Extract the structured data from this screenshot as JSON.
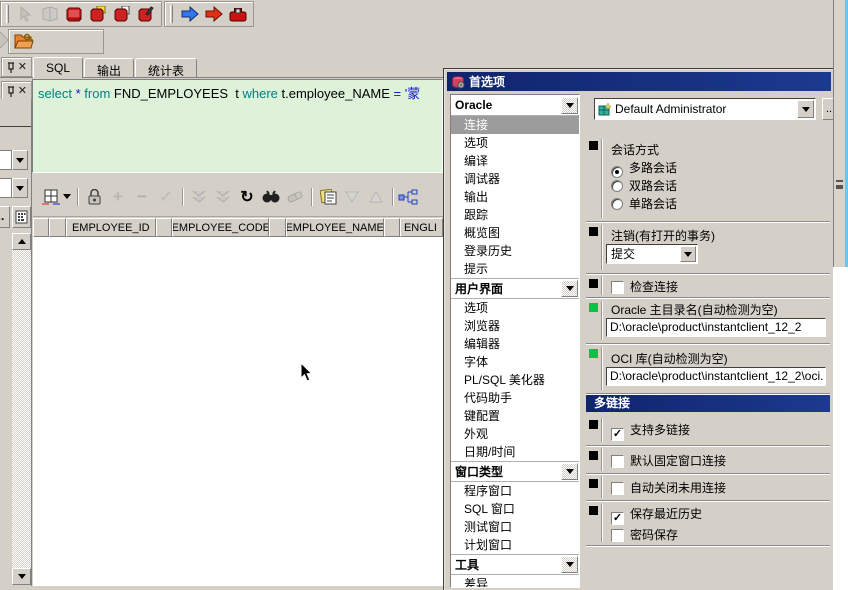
{
  "toolbar_main": {
    "row1_icons": [
      "pointer-tool",
      "book-disabled",
      "book-red",
      "book-note",
      "book-copy",
      "book-edit",
      "arrow-blue-forward",
      "arrow-red-forward",
      "stop-case"
    ],
    "row2_icons": [
      "open-folder-key"
    ]
  },
  "tabs": [
    {
      "label": "SQL",
      "active": true
    },
    {
      "label": "输出",
      "active": false
    },
    {
      "label": "统计表",
      "active": false
    }
  ],
  "sql": {
    "tokens": [
      {
        "t": "select",
        "c": "kw"
      },
      {
        "t": " ",
        "c": "id"
      },
      {
        "t": "*",
        "c": "sym"
      },
      {
        "t": " ",
        "c": "id"
      },
      {
        "t": "from",
        "c": "kw"
      },
      {
        "t": " FND_EMPLOYEES  t ",
        "c": "id"
      },
      {
        "t": "where",
        "c": "kw"
      },
      {
        "t": " t.employee_NAME ",
        "c": "id"
      },
      {
        "t": "=",
        "c": "sym"
      },
      {
        "t": " ",
        "c": "id"
      },
      {
        "t": "'蒙",
        "c": "str"
      }
    ]
  },
  "grid": {
    "toolbar_icons": [
      "grid-view",
      "record-lock",
      "insert-record",
      "delete-record",
      "post-record",
      "fetch-next-page",
      "fetch-last-page",
      "refresh",
      "find",
      "clear",
      "export-data",
      "sort-descending",
      "sort-ascending",
      "linked-query"
    ],
    "columns": [
      "EMPLOYEE_ID",
      "EMPLOYEE_CODE",
      "EMPLOYEE_NAME",
      "ENGLI"
    ]
  },
  "dialog": {
    "title": "首选项",
    "profile": {
      "value": "Default Administrator",
      "more_label": ".."
    },
    "nav": [
      {
        "label": "Oracle",
        "items": [
          {
            "label": "连接",
            "selected": true
          },
          {
            "label": "选项",
            "selected": false
          },
          {
            "label": "编译",
            "selected": false
          },
          {
            "label": "调试器",
            "selected": false
          },
          {
            "label": "输出",
            "selected": false
          },
          {
            "label": "跟踪",
            "selected": false
          },
          {
            "label": "概览图",
            "selected": false
          },
          {
            "label": "登录历史",
            "selected": false
          },
          {
            "label": "提示",
            "selected": false
          }
        ]
      },
      {
        "label": "用户界面",
        "items": [
          {
            "label": "选项",
            "selected": false
          },
          {
            "label": "浏览器",
            "selected": false
          },
          {
            "label": "编辑器",
            "selected": false
          },
          {
            "label": "字体",
            "selected": false
          },
          {
            "label": "PL/SQL 美化器",
            "selected": false
          },
          {
            "label": "代码助手",
            "selected": false
          },
          {
            "label": "键配置",
            "selected": false
          },
          {
            "label": "外观",
            "selected": false
          },
          {
            "label": "日期/时间",
            "selected": false
          }
        ]
      },
      {
        "label": "窗口类型",
        "items": [
          {
            "label": "程序窗口",
            "selected": false
          },
          {
            "label": "SQL 窗口",
            "selected": false
          },
          {
            "label": "测试窗口",
            "selected": false
          },
          {
            "label": "计划窗口",
            "selected": false
          }
        ]
      },
      {
        "label": "工具",
        "items": [
          {
            "label": "差异",
            "selected": false
          }
        ]
      }
    ],
    "session_mode": {
      "title": "会话方式",
      "options": [
        {
          "label": "多路会话",
          "selected": true
        },
        {
          "label": "双路会话",
          "selected": false
        },
        {
          "label": "单路会话",
          "selected": false
        }
      ]
    },
    "logoff": {
      "label": "注销(有打开的事务)",
      "value": "提交"
    },
    "check_connection": {
      "label": "检查连接",
      "checked": false
    },
    "oracle_home": {
      "label": "Oracle 主目录名(自动检测为空)",
      "value": "D:\\oracle\\product\\instantclient_12_2"
    },
    "oci_library": {
      "label": "OCI 库(自动检测为空)",
      "value": "D:\\oracle\\product\\instantclient_12_2\\oci."
    },
    "multilink": {
      "title": "多链接",
      "checks": [
        {
          "label": "支持多链接",
          "checked": true
        },
        {
          "label": "默认固定窗口连接",
          "checked": false
        },
        {
          "label": "自动关闭未用连接",
          "checked": false
        },
        {
          "label": "保存最近历史",
          "checked": true
        },
        {
          "label": "密码保存",
          "checked": false
        }
      ]
    }
  },
  "colors": {
    "titlebar": "#10246e",
    "editor_bg": "#def2da",
    "keyword": "#007f80",
    "symbol": "#1414c8",
    "selected_nav_bg": "#9c9c9c",
    "marker_green": "#00c648",
    "edge_cyan": "#6ec6e6"
  },
  "glyphs": {
    "close": "✕",
    "more": "..",
    "check": "✓"
  }
}
